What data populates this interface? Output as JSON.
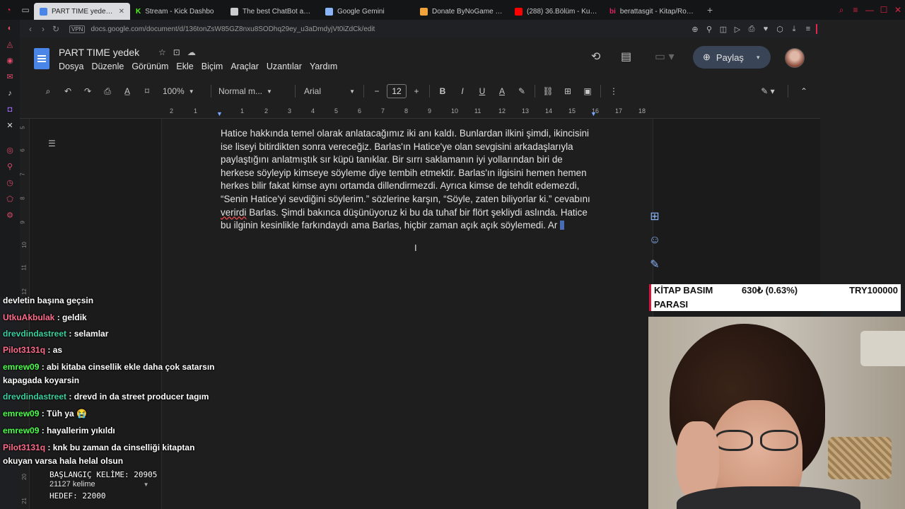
{
  "browser": {
    "tabs": [
      {
        "label": "PART TIME yedek - Goog",
        "color": "#4a86e8",
        "active": true
      },
      {
        "label": "Stream - Kick Dashbo",
        "color": "#53fc18",
        "active": false
      },
      {
        "label": "The best ChatBot and W",
        "color": "#cccccc",
        "active": false
      },
      {
        "label": "Google Gemini",
        "color": "#8ab4f8",
        "active": false
      },
      {
        "label": "Donate ByNoGame - Gel",
        "color": "#f2a33a",
        "active": false
      },
      {
        "label": "(288) 36.Bölüm - Kurtlar",
        "color": "#ff0000",
        "active": false
      },
      {
        "label": "berattasgit - Kitap/Roman",
        "color": "#e0245e",
        "active": false
      }
    ],
    "tab_prefixes": [
      "",
      "K",
      "",
      "",
      "",
      "",
      "bi"
    ],
    "url": "docs.google.com/document/d/136tonZsW85GZ8nxu8SODhq29ey_u3aDmdyjVt0iZdCk/edit",
    "vpn_label": "VPN"
  },
  "docs": {
    "title": "PART TIME  yedek",
    "menus": [
      "Dosya",
      "Düzenle",
      "Görünüm",
      "Ekle",
      "Biçim",
      "Araçlar",
      "Uzantılar",
      "Yardım"
    ],
    "share_label": "Paylaş",
    "zoom": "100%",
    "style": "Normal m...",
    "font": "Arial",
    "font_size": "12",
    "ruler": [
      "2",
      "1",
      "1",
      "2",
      "3",
      "4",
      "5",
      "6",
      "7",
      "8",
      "9",
      "10",
      "11",
      "12",
      "13",
      "14",
      "15",
      "16",
      "17",
      "18"
    ],
    "vruler": [
      "5",
      "6",
      "7",
      "8",
      "9",
      "10",
      "11",
      "12",
      "20",
      "21"
    ],
    "body_text_1": "Hatice hakkında temel olarak anlatacağımız iki anı kaldı. Bunlardan ilkini şimdi, ikincisini ise liseyi bitirdikten sonra vereceğiz. Barlas'ın Hatice'ye olan sevgisini arkadaşlarıyla paylaştığını anlatmıştık sır küpü tanıklar. Bir sırrı saklamanın iyi yollarından biri de herkese söyleyip kimseye söyleme diye tembih etmektir. Barlas'ın ilgisini hemen hemen herkes bilir fakat kimse aynı ortamda dillendirmezdi. Ayrıca kimse de tehdit edemezdi, “Senin Hatice'yi sevdiğini söylerim.” sözlerine karşın, “Söyle, zaten biliyorlar ki.” cevabını ",
    "body_text_squig": "verirdi",
    "body_text_2": " Barlas. Şimdi bakınca düşünüyoruz ki bu da tuhaf bir flört şekliydi aslında. Hatice bu ilginin kesinlikle farkındaydı ama Barlas, hiçbir zaman açık açık söylemedi. Ar"
  },
  "chat": [
    {
      "user": "",
      "color": "#ffffff",
      "text": "devletin başına geçsin"
    },
    {
      "user": "UtkuAkbulak",
      "color": "#ff6b8b",
      "text": " : geldik"
    },
    {
      "user": "drevdindastreet",
      "color": "#3ad1a0",
      "text": " : selamlar"
    },
    {
      "user": "Pilot3131q",
      "color": "#ff6b8b",
      "text": " : as"
    },
    {
      "user": "emrew09",
      "color": "#4cff4c",
      "text": " : abi kitaba cinsellik ekle daha çok satarsın kapagada koyarsin"
    },
    {
      "user": "drevdindastreet",
      "color": "#3ad1a0",
      "text": " : drevd in da street producer tagım"
    },
    {
      "user": "emrew09",
      "color": "#4cff4c",
      "text": " : Tüh ya 😭"
    },
    {
      "user": "emrew09",
      "color": "#4cff4c",
      "text": " : hayallerim yıkıldı"
    },
    {
      "user": "Pilot3131q",
      "color": "#ff6b8b",
      "text": " : knk bu zaman da cinselliği kitaptan okuyan varsa hala helal olsun"
    }
  ],
  "counter": {
    "start": "BAŞLANGIÇ KELİME: 20905",
    "words": "21127 kelime",
    "target": "HEDEF: 22000"
  },
  "ticker": {
    "label1": "KİTAP BASIM",
    "value": "630₺ (0.63%)",
    "goal": "TRY100000",
    "label2": "PARASI"
  }
}
